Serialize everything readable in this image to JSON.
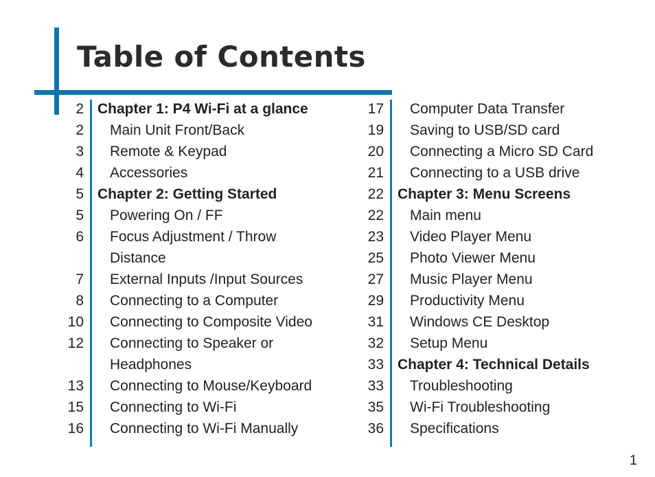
{
  "document": {
    "title": "Table of Contents",
    "footer_page_number": "1",
    "accent_color": "#0e76ae",
    "rule_color": "#1279b3",
    "text_color": "#231f20",
    "title_color": "#2b2b2b"
  },
  "toc": {
    "left_column": [
      {
        "page": "2",
        "label": "Chapter 1: P4 Wi-Fi at a glance",
        "level": "chapter"
      },
      {
        "page": "2",
        "label": "Main Unit Front/Back",
        "level": "section"
      },
      {
        "page": "3",
        "label": "Remote & Keypad",
        "level": "section"
      },
      {
        "page": "4",
        "label": "Accessories",
        "level": "section"
      },
      {
        "page": "5",
        "label": "Chapter 2: Getting Started",
        "level": "chapter"
      },
      {
        "page": "5",
        "label": "Powering On / FF",
        "level": "section"
      },
      {
        "page": "6",
        "label": "Focus Adjustment / Throw",
        "level": "section"
      },
      {
        "page": "",
        "label": "Distance",
        "level": "continuation"
      },
      {
        "page": "7",
        "label": "External Inputs /Input Sources",
        "level": "section"
      },
      {
        "page": "8",
        "label": "Connecting to a Computer",
        "level": "section"
      },
      {
        "page": "10",
        "label": "Connecting to Composite Video",
        "level": "section"
      },
      {
        "page": "12",
        "label": "Connecting to Speaker or",
        "level": "section"
      },
      {
        "page": "",
        "label": "Headphones",
        "level": "continuation"
      },
      {
        "page": "13",
        "label": "Connecting to Mouse/Keyboard",
        "level": "section"
      },
      {
        "page": "15",
        "label": "Connecting to Wi-Fi",
        "level": "section"
      },
      {
        "page": "16",
        "label": "Connecting to Wi-Fi Manually",
        "level": "section"
      }
    ],
    "right_column": [
      {
        "page": "17",
        "label": "Computer Data Transfer",
        "level": "section"
      },
      {
        "page": "19",
        "label": "Saving to USB/SD card",
        "level": "section"
      },
      {
        "page": "20",
        "label": "Connecting a Micro SD Card",
        "level": "section"
      },
      {
        "page": "21",
        "label": "Connecting to a USB drive",
        "level": "section"
      },
      {
        "page": "22",
        "label": "Chapter 3: Menu Screens",
        "level": "chapter"
      },
      {
        "page": "22",
        "label": "Main menu",
        "level": "section"
      },
      {
        "page": "23",
        "label": "Video Player Menu",
        "level": "section"
      },
      {
        "page": "25",
        "label": "Photo Viewer Menu",
        "level": "section"
      },
      {
        "page": "27",
        "label": "Music Player Menu",
        "level": "section"
      },
      {
        "page": "29",
        "label": "Productivity Menu",
        "level": "section"
      },
      {
        "page": "31",
        "label": "Windows CE Desktop",
        "level": "section"
      },
      {
        "page": "32",
        "label": "Setup Menu",
        "level": "section"
      },
      {
        "page": "33",
        "label": "Chapter 4: Technical Details",
        "level": "chapter"
      },
      {
        "page": "33",
        "label": "Troubleshooting",
        "level": "section"
      },
      {
        "page": "35",
        "label": "Wi-Fi Troubleshooting",
        "level": "section"
      },
      {
        "page": "36",
        "label": "Specifications",
        "level": "section"
      }
    ]
  }
}
